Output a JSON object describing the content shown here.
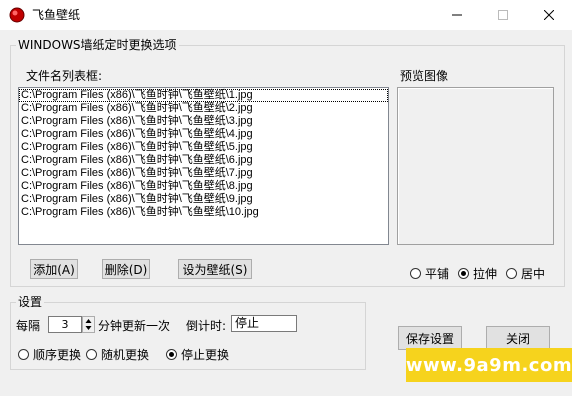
{
  "window": {
    "title": "飞鱼壁纸",
    "controls": [
      "minimize-icon",
      "maximize-icon",
      "close-icon"
    ]
  },
  "schedule_group": {
    "label": "WINDOWS墙纸定时更换选项",
    "list_label": "文件名列表框:",
    "preview_label": "预览图像",
    "files": [
      "C:\\Program Files (x86)\\飞鱼时钟\\飞鱼壁纸\\1.jpg",
      "C:\\Program Files (x86)\\飞鱼时钟\\飞鱼壁纸\\2.jpg",
      "C:\\Program Files (x86)\\飞鱼时钟\\飞鱼壁纸\\3.jpg",
      "C:\\Program Files (x86)\\飞鱼时钟\\飞鱼壁纸\\4.jpg",
      "C:\\Program Files (x86)\\飞鱼时钟\\飞鱼壁纸\\5.jpg",
      "C:\\Program Files (x86)\\飞鱼时钟\\飞鱼壁纸\\6.jpg",
      "C:\\Program Files (x86)\\飞鱼时钟\\飞鱼壁纸\\7.jpg",
      "C:\\Program Files (x86)\\飞鱼时钟\\飞鱼壁纸\\8.jpg",
      "C:\\Program Files (x86)\\飞鱼时钟\\飞鱼壁纸\\9.jpg",
      "C:\\Program Files (x86)\\飞鱼时钟\\飞鱼壁纸\\10.jpg"
    ],
    "add_button": "添加(A)",
    "delete_button": "删除(D)",
    "set_wallpaper_button": "设为壁纸(S)",
    "display_modes": [
      {
        "label": "平铺",
        "checked": false
      },
      {
        "label": "拉伸",
        "checked": true
      },
      {
        "label": "居中",
        "checked": false
      }
    ]
  },
  "settings_group": {
    "label": "设置",
    "every_label": "每隔",
    "interval_value": "3",
    "interval_suffix": "分钟更新一次",
    "countdown_label": "倒计时:",
    "countdown_value": "停止",
    "order_modes": [
      {
        "label": "顺序更换",
        "checked": false
      },
      {
        "label": "随机更换",
        "checked": false
      },
      {
        "label": "停止更换",
        "checked": true
      }
    ]
  },
  "footer": {
    "save_button": "保存设置",
    "close_button": "关闭",
    "watermark": "www.9a9m.com",
    "watermark_color": "#f6d31d",
    "watermark_text_color": "#ffffff"
  }
}
